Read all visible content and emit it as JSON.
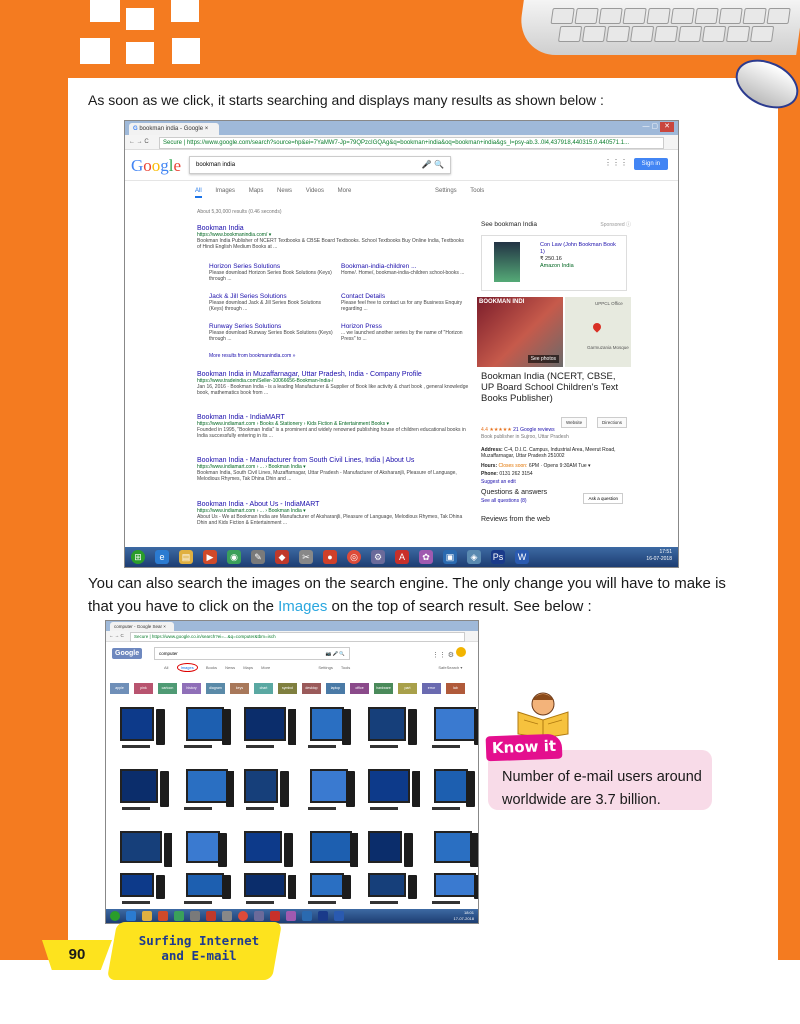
{
  "page": {
    "intro_text": "As soon as we click, it starts searching and displays many results as shown below :",
    "para2_line1": "You can also search the images on the search engine. The only change you will have to make is",
    "para2_line2_pre": "that you have to click on the ",
    "para2_line2_highlight": "Images",
    "para2_line2_post": " on the top of search result. See below :",
    "know_it_label": "Know it",
    "know_it_text": "Number of e-mail users around worldwide are 3.7 billion.",
    "page_number": "90",
    "chapter_line1": "Surfing Internet",
    "chapter_line2": "and E-mail"
  },
  "shot1": {
    "tab_title": "bookman india - Google",
    "address": "Secure | https://www.google.com/search?source=hp&ei=7YaMW7-Jp=79QPzcIGQAg&q=bookman+india&oq=bookman+india&gs_l=psy-ab.3..0l4,437918,440315.0.440571.1...",
    "logo": "Google",
    "query": "bookman india",
    "sign_in": "Sign in",
    "tabs": [
      "All",
      "Images",
      "Maps",
      "News",
      "Videos",
      "More"
    ],
    "tabs_right": [
      "Settings",
      "Tools"
    ],
    "stats": "About 5,30,000 results (0.46 seconds)",
    "results": [
      {
        "title": "Bookman India",
        "url": "https://www.bookmanindia.com/ ▾",
        "desc": "Bookman India Publisher of NCERT Textbooks & CBSE Board Textbooks. School Textbooks Buy Online India, Textbooks of Hindi English Medium Books at ..."
      },
      {
        "title": "Bookman India in Muzaffarnagar, Uttar Pradesh, India - Company Profile",
        "url": "https://www.tradeindia.com/Seller-10066656-Bookman-India-/",
        "desc": "Jan 16, 2016 · Bookman India - is a leading Manufacturer & Supplier of Book like activity & chart book , general knowledge book, mathematics book from ..."
      },
      {
        "title": "Bookman India - IndiaMART",
        "url": "https://www.indiamart.com › Books & Stationery › Kids Fiction & Entertainment Books ▾",
        "desc": "Founded in 1995, \"Bookman India\" is a prominent and widely renowned publishing house of children educational books in India successfully entering in its ..."
      },
      {
        "title": "Bookman India - Manufacturer from South Civil Lines, India | About Us",
        "url": "https://www.indiamart.com › ... › Bookman India ▾",
        "desc": "Bookman India, South Civil Lines, Muzaffarnagar, Uttar Pradesh - Manufacturer of Aksharanjli, Pleasure of Language, Melodious Rhymes, Tak Dhina Dhin and ..."
      },
      {
        "title": "Bookman India - About Us - IndiaMART",
        "url": "https://www.indiamart.com › ... › Bookman India ▾",
        "desc": "About Us - We at Bookman India are Manufacturer of Aksharanjli, Pleasure of Language, Melodious Rhymes, Tak Dhina Dhin and Kids Fiction & Entertainment ..."
      }
    ],
    "sublinks": [
      {
        "title": "Horizon Series Solutions",
        "desc": "Please download Horizon Series Book Solutions (Keys) through ..."
      },
      {
        "title": "Bookman-india-children ...",
        "desc": "Home/. Home/, bookman-india-children school-books ..."
      },
      {
        "title": "Jack & Jill Series Solutions",
        "desc": "Please download Jack & Jill Series Book Solutions (Keys) through ..."
      },
      {
        "title": "Contact Details",
        "desc": "Please feel free to contact us for any Business Enquiry regarding ..."
      },
      {
        "title": "Runway Series Solutions",
        "desc": "Please download Runway Series Book Solutions (Keys) through ..."
      },
      {
        "title": "Horizon Press",
        "desc": "... we launched another series by the name of \"Horizon Press\" to ..."
      }
    ],
    "more_results": "More results from bookmanindia.com »",
    "kp": {
      "see_title": "See bookman India",
      "sponsored": "Sponsored ⓘ",
      "ad_title": "Con Law (John Bookman Book 1)",
      "ad_price": "₹ 250.16",
      "ad_seller": "Amazon India",
      "photo_label": "BOOKMAN INDI",
      "see_photos": "See photos",
      "map_label1": "UPPCL Office",
      "map_label2": "Garmuzania Mosque",
      "name": "Bookman India (NCERT, CBSE, UP Board School Children's Text Books Publisher)",
      "website": "Website",
      "directions": "Directions",
      "rating": "4.4 ★★★★★",
      "reviews": "21 Google reviews",
      "type": "Book publisher in Sujroo, Uttar Pradesh",
      "address_label": "Address:",
      "address": "C-4, D.I.C. Campus, Industrial Area, Meerut Road, Muzaffarnagar, Uttar Pradesh 251002",
      "hours_label": "Hours:",
      "hours_closes": "Closes soon:",
      "hours": "6PM · Opens 9:30AM Tue ▾",
      "phone_label": "Phone:",
      "phone": "0131 262 3154",
      "suggest": "Suggest an edit",
      "qa": "Questions & answers",
      "see_all_q": "See all questions (8)",
      "ask": "Ask a question",
      "reviews_web": "Reviews from the web"
    },
    "time": "17:51",
    "date": "16-07-2018"
  },
  "shot2": {
    "tab_title": "computer - Google Sear",
    "address": "Secure | https://www.google.co.in/search?ei=...&q=computer&tbm=isch",
    "logo": "Google",
    "query": "computer",
    "tabs": [
      "All",
      "Images",
      "Books",
      "News",
      "Maps",
      "More"
    ],
    "tabs_right": [
      "Settings",
      "Tools",
      "SafeSearch ▾"
    ],
    "chips": [
      "apple",
      "pink",
      "cartoon",
      "history",
      "diagram",
      "keys",
      "chart",
      "symbol",
      "desktop",
      "laptop",
      "office",
      "hardware",
      "part",
      "error",
      "lab"
    ],
    "chip_colors": [
      "#6f8fb8",
      "#b8546f",
      "#4f9a74",
      "#8f6fb8",
      "#5a8aa8",
      "#a8785a",
      "#5aa8a2",
      "#7f7f3f",
      "#9a5a5a",
      "#4a7aa6",
      "#8a4a8a",
      "#4a8a5a",
      "#a8a04a",
      "#6a6ab0",
      "#b05a3a"
    ],
    "time": "18:01",
    "date": "17-07-2018"
  },
  "colors": {
    "orange": "#f47b20",
    "yellow": "#fde31e",
    "know_pink": "#e40f8e",
    "know_box": "#f8dbe8",
    "highlight_blue": "#2aa7df"
  }
}
